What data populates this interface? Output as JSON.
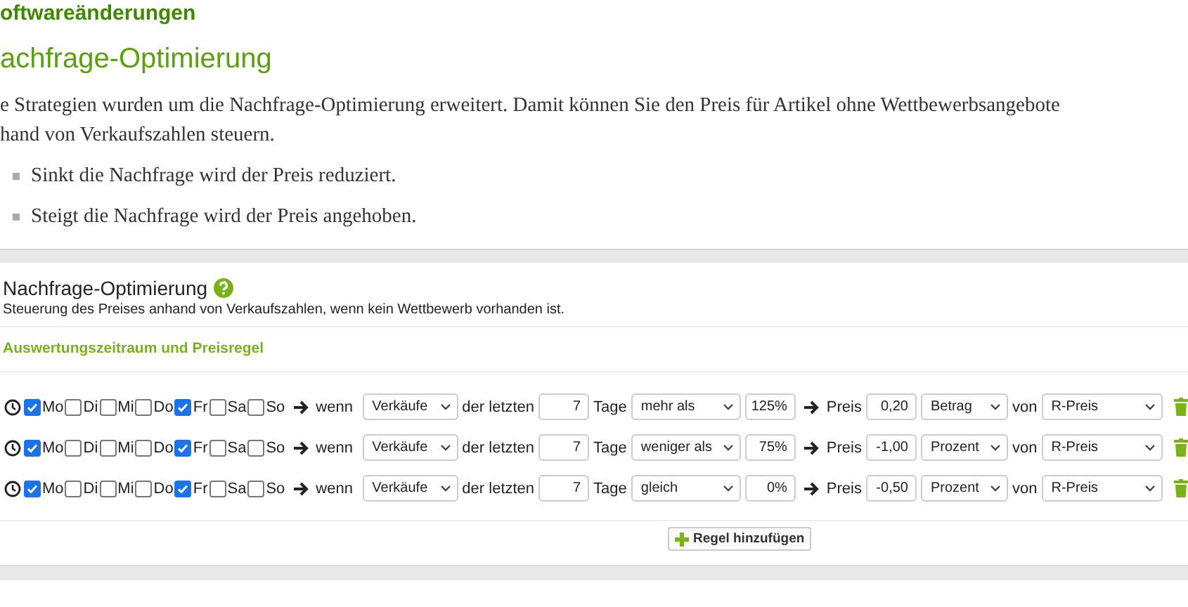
{
  "section_heading": "oftwareänderungen",
  "page_heading": "achfrage-Optimierung",
  "intro_lines": [
    "e Strategien wurden um die Nachfrage-Optimierung erweitert. Damit können Sie den Preis für Artikel ohne Wettbewerbsangebote",
    "hand von Verkaufszahlen steuern."
  ],
  "bullets": [
    "Sinkt die Nachfrage wird der Preis reduziert.",
    "Steigt die Nachfrage wird der Preis angehoben."
  ],
  "card": {
    "title": "Nachfrage-Optimierung",
    "subtitle": "Steuerung des Preises anhand von Verkaufszahlen, wenn kein Wettbewerb vorhanden ist.",
    "section_title": "Auswertungszeitraum und Preisregel",
    "rules": [
      {
        "days": [
          {
            "label": "Mo",
            "checked": true
          },
          {
            "label": "Di",
            "checked": false
          },
          {
            "label": "Mi",
            "checked": false
          },
          {
            "label": "Do",
            "checked": false
          },
          {
            "label": "Fr",
            "checked": true
          },
          {
            "label": "Sa",
            "checked": false
          },
          {
            "label": "So",
            "checked": false
          }
        ],
        "if_label": "wenn",
        "metric": "Verkäufe",
        "period_label": "der letzten",
        "period": "7",
        "unit_label": "Tage",
        "comparison": "mehr als",
        "threshold": "125%",
        "price_label": "Preis",
        "amount": "0,20",
        "amount_type": "Betrag",
        "of_label": "von",
        "base": "R-Preis"
      },
      {
        "days": [
          {
            "label": "Mo",
            "checked": true
          },
          {
            "label": "Di",
            "checked": false
          },
          {
            "label": "Mi",
            "checked": false
          },
          {
            "label": "Do",
            "checked": false
          },
          {
            "label": "Fr",
            "checked": true
          },
          {
            "label": "Sa",
            "checked": false
          },
          {
            "label": "So",
            "checked": false
          }
        ],
        "if_label": "wenn",
        "metric": "Verkäufe",
        "period_label": "der letzten",
        "period": "7",
        "unit_label": "Tage",
        "comparison": "weniger als",
        "threshold": "75%",
        "price_label": "Preis",
        "amount": "-1,00",
        "amount_type": "Prozent",
        "of_label": "von",
        "base": "R-Preis"
      },
      {
        "days": [
          {
            "label": "Mo",
            "checked": true
          },
          {
            "label": "Di",
            "checked": false
          },
          {
            "label": "Mi",
            "checked": false
          },
          {
            "label": "Do",
            "checked": false
          },
          {
            "label": "Fr",
            "checked": true
          },
          {
            "label": "Sa",
            "checked": false
          },
          {
            "label": "So",
            "checked": false
          }
        ],
        "if_label": "wenn",
        "metric": "Verkäufe",
        "period_label": "der letzten",
        "period": "7",
        "unit_label": "Tage",
        "comparison": "gleich",
        "threshold": "0%",
        "price_label": "Preis",
        "amount": "-0,50",
        "amount_type": "Prozent",
        "of_label": "von",
        "base": "R-Preis"
      }
    ],
    "add_button": "Regel hinzufügen"
  }
}
